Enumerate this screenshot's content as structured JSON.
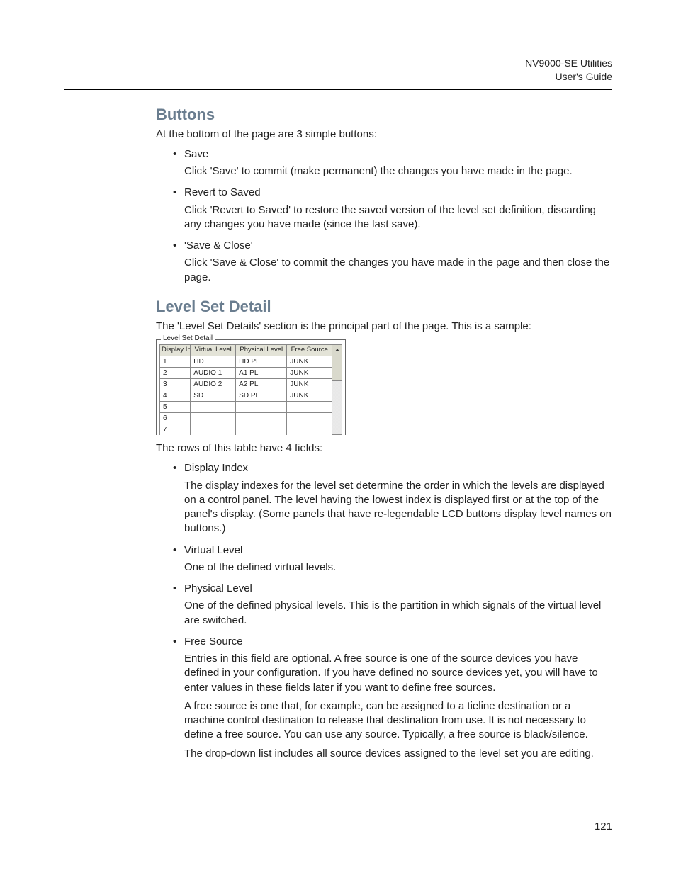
{
  "header": {
    "title": "NV9000-SE Utilities",
    "subtitle": "User's Guide"
  },
  "sections": {
    "buttons": {
      "heading": "Buttons",
      "lead": "At the bottom of the page are 3 simple buttons:",
      "items": [
        {
          "title": "Save",
          "desc": [
            "Click 'Save' to commit (make permanent) the changes you have made in the page."
          ]
        },
        {
          "title": "Revert to Saved",
          "desc": [
            "Click 'Revert to Saved' to restore the saved version of the level set definition, discarding any changes you have made (since the last save)."
          ]
        },
        {
          "title": "'Save & Close'",
          "desc": [
            "Click 'Save & Close' to commit the changes you have made in the page and then close the page."
          ]
        }
      ]
    },
    "levelSetDetail": {
      "heading": "Level Set Detail",
      "lead": "The 'Level Set Details' section is the principal part of the page. This is a sample:",
      "legend": "Level Set Detail",
      "tableHeaders": {
        "displayIndex": "Display Index",
        "virtualLevel": "Virtual Level",
        "physicalLevel": "Physical Level",
        "freeSource": "Free Source"
      },
      "rows": [
        {
          "idx": "1",
          "vl": "HD",
          "pl": "HD PL",
          "fs": "JUNK"
        },
        {
          "idx": "2",
          "vl": "AUDIO 1",
          "pl": "A1 PL",
          "fs": "JUNK"
        },
        {
          "idx": "3",
          "vl": "AUDIO 2",
          "pl": "A2 PL",
          "fs": "JUNK"
        },
        {
          "idx": "4",
          "vl": "SD",
          "pl": "SD PL",
          "fs": "JUNK"
        },
        {
          "idx": "5",
          "vl": "",
          "pl": "",
          "fs": ""
        },
        {
          "idx": "6",
          "vl": "",
          "pl": "",
          "fs": ""
        },
        {
          "idx": "7",
          "vl": "",
          "pl": "",
          "fs": ""
        }
      ],
      "afterTable": "The rows of this table have 4 fields:",
      "fields": [
        {
          "title": "Display Index",
          "desc": [
            "The display indexes for the level set determine the order in which the levels are displayed on a control panel. The level having the lowest index is displayed first or at the top of the panel's display. (Some panels that have re-legendable LCD buttons display level names on buttons.)"
          ]
        },
        {
          "title": "Virtual Level",
          "desc": [
            "One of the defined virtual levels."
          ]
        },
        {
          "title": "Physical Level",
          "desc": [
            "One of the defined physical levels. This is the partition in which signals of the virtual level are switched."
          ]
        },
        {
          "title": "Free Source",
          "desc": [
            "Entries in this field are optional. A free source is one of the source devices you have defined in your configuration. If you have defined no source devices yet, you will have to enter values in these fields later if you want to define free sources.",
            "A free source is one that, for example, can be assigned to a tieline destination or a machine control destination to release that destination from use. It is not necessary to define a free source. You can use any source. Typically, a free source is black/silence.",
            "The drop-down list includes all source devices assigned to the level set you are editing."
          ]
        }
      ]
    }
  },
  "pageNumber": "121"
}
